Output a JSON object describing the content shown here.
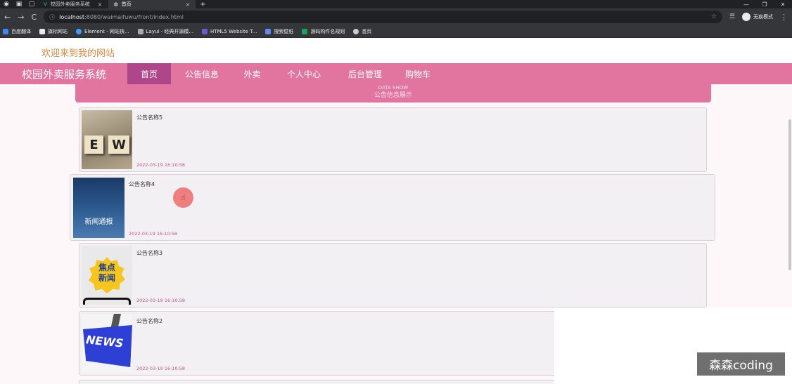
{
  "browser": {
    "tabs": [
      {
        "title": "校园外卖服务系统",
        "active": false
      },
      {
        "title": "首页",
        "active": true
      }
    ],
    "url_host": "localhost",
    "url_path": ":8080/waimaifuwu/front/index.html",
    "profile_label": "无痕模式",
    "bookmarks": [
      "百度翻译",
      "旗标网站",
      "Element - 网站快...",
      "Layui - 经典开源模...",
      "HTML5 Website T...",
      "搜索壁纸",
      "源码构件名规则",
      "首页"
    ]
  },
  "site": {
    "welcome": "欢迎来到我的网站",
    "title": "校园外卖服务系统",
    "nav": [
      "首页",
      "公告信息",
      "外卖",
      "个人中心",
      "后台管理",
      "购物车"
    ],
    "section_en": "DATA SHOW",
    "section_zh": "公告信息展示"
  },
  "notices": [
    {
      "title": "公告名称5",
      "date": "2022-03-19 16:10:58",
      "thumb_text": "E W"
    },
    {
      "title": "公告名称4",
      "date": "2022-03-19 16:10:58",
      "thumb_text": "新闻通报"
    },
    {
      "title": "公告名称3",
      "date": "2022-03-19 16:10:58",
      "thumb_text": "焦点新闻"
    },
    {
      "title": "公告名称2",
      "date": "2022-03-19 16:10:58",
      "thumb_text": "NEWS"
    }
  ],
  "watermark": "森森coding",
  "colors": {
    "accent": "#e274a0",
    "active_nav": "#b0468a",
    "date": "#c0558c",
    "welcome": "#e0893a"
  }
}
